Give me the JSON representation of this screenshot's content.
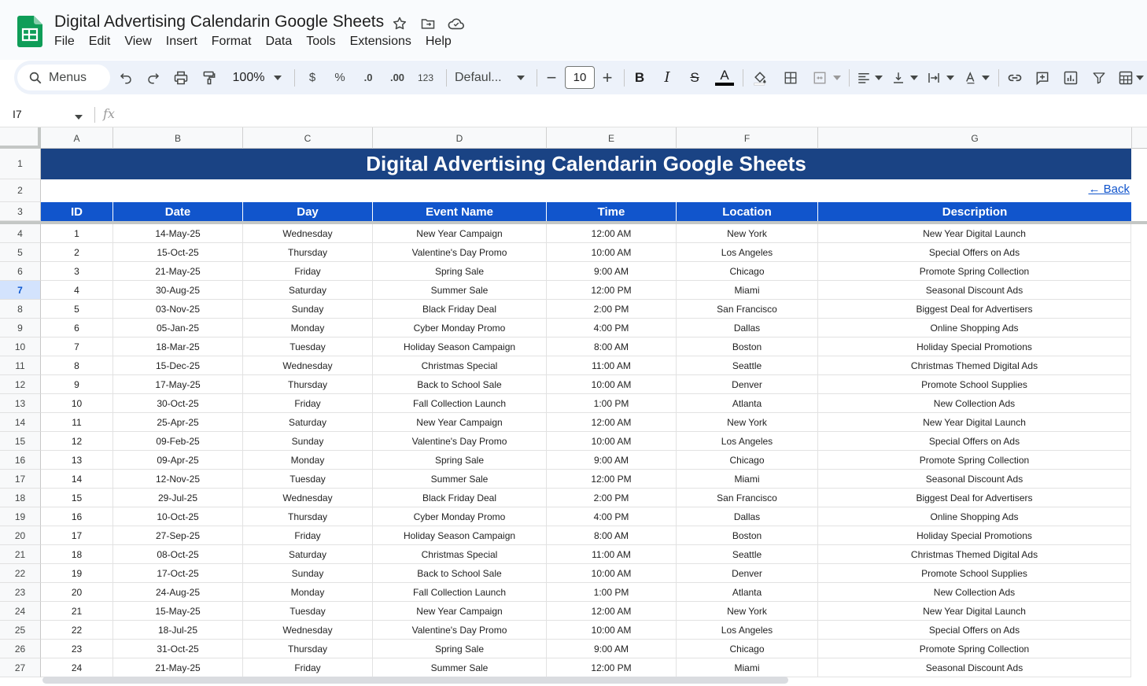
{
  "app": {
    "title": "Digital Advertising Calendarin Google Sheets",
    "menus": [
      "File",
      "Edit",
      "View",
      "Insert",
      "Format",
      "Data",
      "Tools",
      "Extensions",
      "Help"
    ]
  },
  "toolbar": {
    "search_label": "Menus",
    "zoom": "100%",
    "currency": "$",
    "percent": "%",
    "dec_decrease": ".0",
    "dec_increase": ".00",
    "number_format": "123",
    "font": "Defaul...",
    "font_size": "10",
    "minus": "−",
    "plus": "+",
    "bold": "B",
    "italic": "I",
    "strike": "S",
    "text_color": "A",
    "text_color_value": "#000000"
  },
  "formula_bar": {
    "cell_ref": "I7",
    "fx": "fx"
  },
  "grid": {
    "columns": [
      "A",
      "B",
      "C",
      "D",
      "E",
      "F",
      "G"
    ],
    "row_numbers": [
      "1",
      "2",
      "3",
      "4",
      "5",
      "6",
      "7",
      "8",
      "9",
      "10",
      "11",
      "12",
      "13",
      "14",
      "15",
      "16",
      "17",
      "18",
      "19",
      "20",
      "21",
      "22",
      "23",
      "24",
      "25",
      "26",
      "27"
    ],
    "active_row": "7",
    "banner_title": "Digital Advertising Calendarin Google Sheets",
    "back_link": "← Back",
    "headers": [
      "ID",
      "Date",
      "Day",
      "Event Name",
      "Time",
      "Location",
      "Description"
    ],
    "rows": [
      [
        "1",
        "14-May-25",
        "Wednesday",
        "New Year Campaign",
        "12:00 AM",
        "New York",
        "New Year Digital Launch"
      ],
      [
        "2",
        "15-Oct-25",
        "Thursday",
        "Valentine's Day Promo",
        "10:00 AM",
        "Los Angeles",
        "Special Offers on Ads"
      ],
      [
        "3",
        "21-May-25",
        "Friday",
        "Spring Sale",
        "9:00 AM",
        "Chicago",
        "Promote Spring Collection"
      ],
      [
        "4",
        "30-Aug-25",
        "Saturday",
        "Summer Sale",
        "12:00 PM",
        "Miami",
        "Seasonal Discount Ads"
      ],
      [
        "5",
        "03-Nov-25",
        "Sunday",
        "Black Friday Deal",
        "2:00 PM",
        "San Francisco",
        "Biggest Deal for Advertisers"
      ],
      [
        "6",
        "05-Jan-25",
        "Monday",
        "Cyber Monday Promo",
        "4:00 PM",
        "Dallas",
        "Online Shopping Ads"
      ],
      [
        "7",
        "18-Mar-25",
        "Tuesday",
        "Holiday Season Campaign",
        "8:00 AM",
        "Boston",
        "Holiday Special Promotions"
      ],
      [
        "8",
        "15-Dec-25",
        "Wednesday",
        "Christmas Special",
        "11:00 AM",
        "Seattle",
        "Christmas Themed Digital Ads"
      ],
      [
        "9",
        "17-May-25",
        "Thursday",
        "Back to School Sale",
        "10:00 AM",
        "Denver",
        "Promote School Supplies"
      ],
      [
        "10",
        "30-Oct-25",
        "Friday",
        "Fall Collection Launch",
        "1:00 PM",
        "Atlanta",
        "New Collection Ads"
      ],
      [
        "11",
        "25-Apr-25",
        "Saturday",
        "New Year Campaign",
        "12:00 AM",
        "New York",
        "New Year Digital Launch"
      ],
      [
        "12",
        "09-Feb-25",
        "Sunday",
        "Valentine's Day Promo",
        "10:00 AM",
        "Los Angeles",
        "Special Offers on Ads"
      ],
      [
        "13",
        "09-Apr-25",
        "Monday",
        "Spring Sale",
        "9:00 AM",
        "Chicago",
        "Promote Spring Collection"
      ],
      [
        "14",
        "12-Nov-25",
        "Tuesday",
        "Summer Sale",
        "12:00 PM",
        "Miami",
        "Seasonal Discount Ads"
      ],
      [
        "15",
        "29-Jul-25",
        "Wednesday",
        "Black Friday Deal",
        "2:00 PM",
        "San Francisco",
        "Biggest Deal for Advertisers"
      ],
      [
        "16",
        "10-Oct-25",
        "Thursday",
        "Cyber Monday Promo",
        "4:00 PM",
        "Dallas",
        "Online Shopping Ads"
      ],
      [
        "17",
        "27-Sep-25",
        "Friday",
        "Holiday Season Campaign",
        "8:00 AM",
        "Boston",
        "Holiday Special Promotions"
      ],
      [
        "18",
        "08-Oct-25",
        "Saturday",
        "Christmas Special",
        "11:00 AM",
        "Seattle",
        "Christmas Themed Digital Ads"
      ],
      [
        "19",
        "17-Oct-25",
        "Sunday",
        "Back to School Sale",
        "10:00 AM",
        "Denver",
        "Promote School Supplies"
      ],
      [
        "20",
        "24-Aug-25",
        "Monday",
        "Fall Collection Launch",
        "1:00 PM",
        "Atlanta",
        "New Collection Ads"
      ],
      [
        "21",
        "15-May-25",
        "Tuesday",
        "New Year Campaign",
        "12:00 AM",
        "New York",
        "New Year Digital Launch"
      ],
      [
        "22",
        "18-Jul-25",
        "Wednesday",
        "Valentine's Day Promo",
        "10:00 AM",
        "Los Angeles",
        "Special Offers on Ads"
      ],
      [
        "23",
        "31-Oct-25",
        "Thursday",
        "Spring Sale",
        "9:00 AM",
        "Chicago",
        "Promote Spring Collection"
      ],
      [
        "24",
        "21-May-25",
        "Friday",
        "Summer Sale",
        "12:00 PM",
        "Miami",
        "Seasonal Discount Ads"
      ]
    ]
  },
  "colors": {
    "banner": "#1a4384",
    "header": "#1155cc",
    "link": "#1155cc",
    "sheets_green": "#0f9d58"
  }
}
